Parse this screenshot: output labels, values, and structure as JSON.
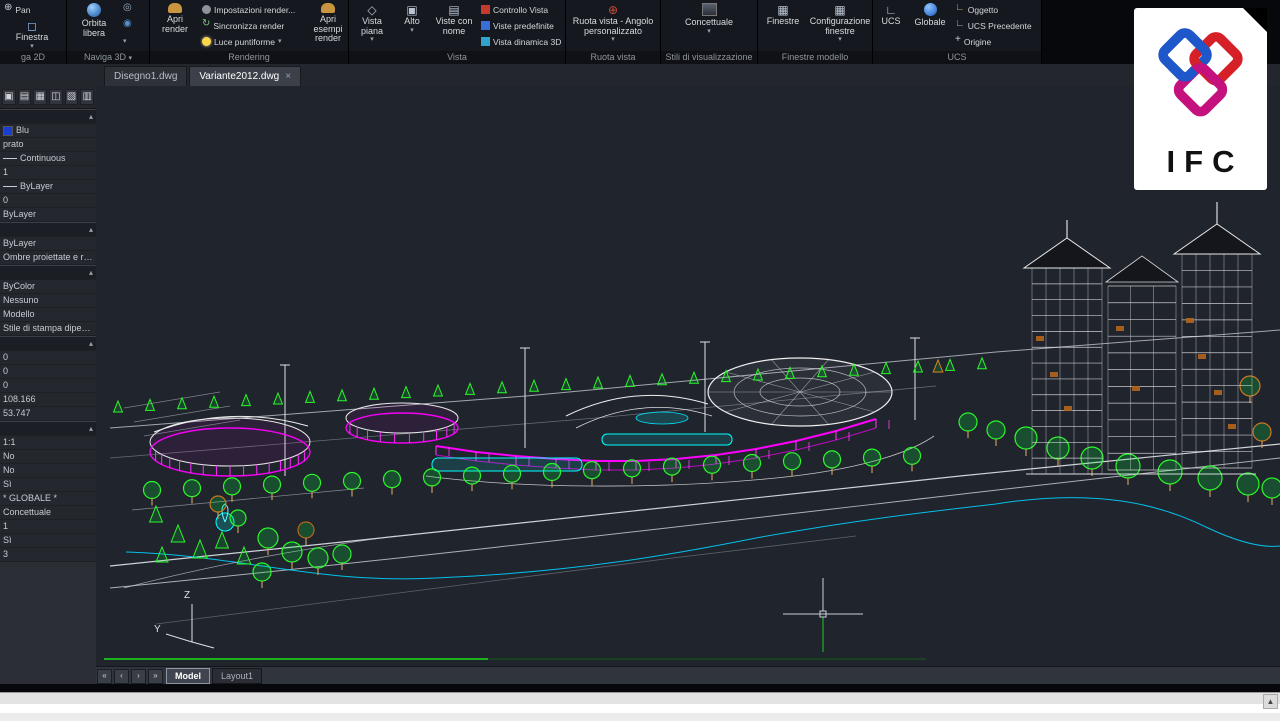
{
  "badge": {
    "label": "IFC"
  },
  "ribbon": {
    "groups": [
      {
        "label": "ga 2D",
        "items": [
          {
            "label": "Pan"
          },
          {
            "label": "Finestra"
          }
        ]
      },
      {
        "label": "Naviga 3D",
        "items": [
          {
            "label": "Orbita libera"
          }
        ]
      },
      {
        "label": "Rendering",
        "items": [
          {
            "label": "Apri render"
          },
          {
            "label": "Impostazioni render..."
          },
          {
            "label": "Sincronizza render"
          },
          {
            "label": "Luce puntiforme"
          },
          {
            "label": "Apri esempi render"
          }
        ]
      },
      {
        "label": "Vista",
        "items": [
          {
            "label": "Vista piana"
          },
          {
            "label": "Alto"
          },
          {
            "label": "Viste con nome"
          },
          {
            "label": "Controllo Vista"
          },
          {
            "label": "Viste predefinite"
          },
          {
            "label": "Vista dinamica 3D"
          }
        ]
      },
      {
        "label": "Ruota vista",
        "items": [
          {
            "label": "Ruota vista - Angolo personalizzato"
          }
        ]
      },
      {
        "label": "Stili di visualizzazione",
        "items": [
          {
            "label": "Concettuale"
          }
        ]
      },
      {
        "label": "Finestre modello",
        "items": [
          {
            "label": "Finestre"
          },
          {
            "label": "Configurazione finestre"
          }
        ]
      },
      {
        "label": "UCS",
        "items": [
          {
            "label": "UCS"
          },
          {
            "label": "Globale"
          },
          {
            "label": "Oggetto"
          },
          {
            "label": "UCS Precedente"
          },
          {
            "label": "Origine"
          }
        ]
      }
    ]
  },
  "doc_tabs": {
    "tabs": [
      {
        "label": "Disegno1.dwg",
        "active": false
      },
      {
        "label": "Variante2012.dwg",
        "active": true
      }
    ],
    "close_glyph": "×"
  },
  "properties": {
    "rows": [
      {
        "type": "section"
      },
      {
        "type": "value",
        "text": "Blu",
        "swatch": "#1a3fd0"
      },
      {
        "type": "value",
        "text": "prato"
      },
      {
        "type": "value",
        "text": "Continuous",
        "line": true
      },
      {
        "type": "value",
        "text": "1"
      },
      {
        "type": "value",
        "text": "ByLayer",
        "line": true
      },
      {
        "type": "value",
        "text": "0"
      },
      {
        "type": "value",
        "text": "ByLayer"
      },
      {
        "type": "section"
      },
      {
        "type": "value",
        "text": "ByLayer"
      },
      {
        "type": "value",
        "text": "Ombre proiettate e ric..."
      },
      {
        "type": "section"
      },
      {
        "type": "value",
        "text": "ByColor"
      },
      {
        "type": "value",
        "text": "Nessuno"
      },
      {
        "type": "value",
        "text": "Modello"
      },
      {
        "type": "value",
        "text": "Stile di stampa dipend..."
      },
      {
        "type": "section"
      },
      {
        "type": "value",
        "text": "0"
      },
      {
        "type": "value",
        "text": "0"
      },
      {
        "type": "value",
        "text": "0"
      },
      {
        "type": "value",
        "text": "108.166"
      },
      {
        "type": "value",
        "text": "53.747"
      },
      {
        "type": "section"
      },
      {
        "type": "value",
        "text": "1:1"
      },
      {
        "type": "value",
        "text": "No"
      },
      {
        "type": "value",
        "text": "No"
      },
      {
        "type": "value",
        "text": "Sì"
      },
      {
        "type": "value",
        "text": "* GLOBALE *"
      },
      {
        "type": "value",
        "text": "Concettuale"
      },
      {
        "type": "value",
        "text": "1"
      },
      {
        "type": "value",
        "text": "Sì"
      },
      {
        "type": "value",
        "text": "3"
      }
    ]
  },
  "viewport": {
    "ucs_z": "Z",
    "ucs_y": "Y"
  },
  "model_bar": {
    "nav": [
      "«",
      "‹",
      "›",
      "»"
    ],
    "tabs": [
      {
        "label": "Model",
        "active": true
      },
      {
        "label": "Layout1",
        "active": false
      }
    ]
  },
  "status_bar": {
    "scroll_up": "▲"
  },
  "colors": {
    "tree_green": "#2bf72b",
    "autumn_orange": "#cc7722",
    "building_magenta": "#ff00ff",
    "water_cyan": "#00ffff",
    "wire_white": "#e8e8e8"
  }
}
